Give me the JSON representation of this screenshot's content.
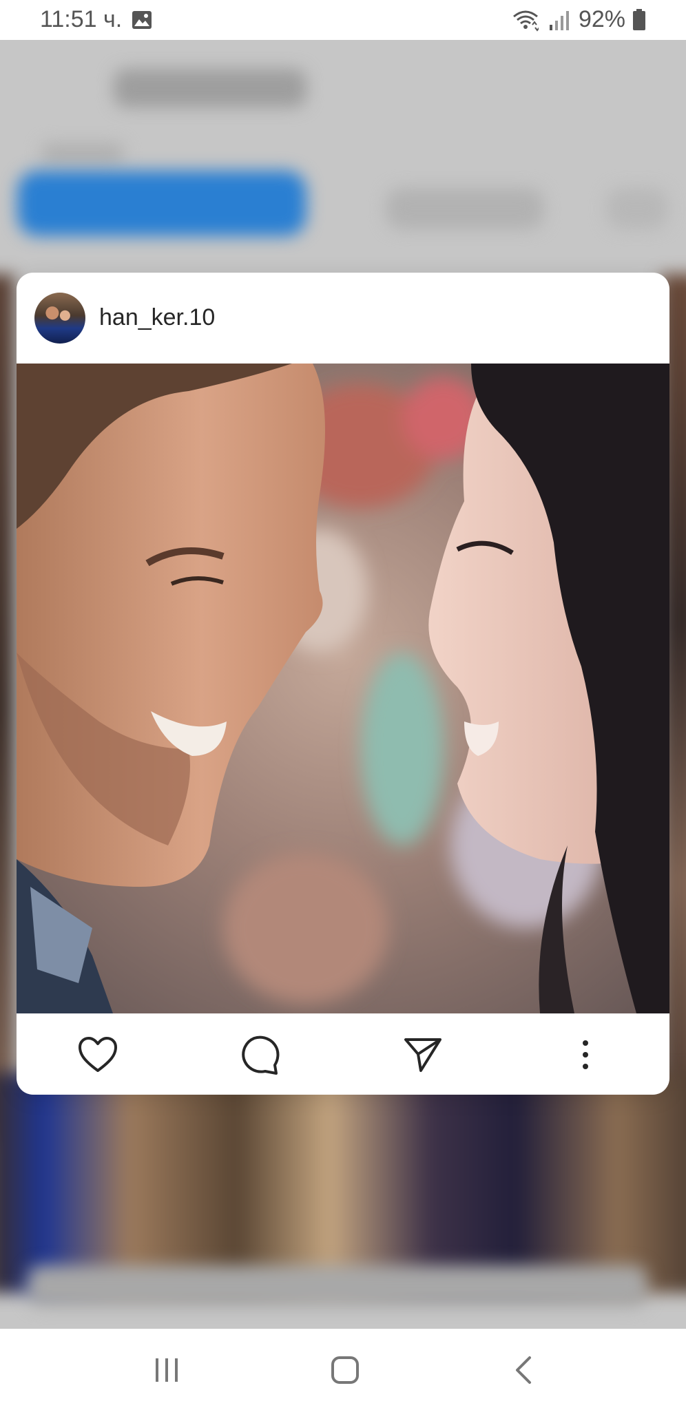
{
  "status_bar": {
    "time": "11:51 ч.",
    "battery": "92%",
    "icons": [
      "gallery-icon",
      "wifi-icon",
      "signal-icon",
      "battery-icon"
    ]
  },
  "post": {
    "username": "han_ker.10",
    "actions": [
      "heart-icon",
      "comment-icon",
      "send-icon",
      "more-icon"
    ]
  },
  "nav_bar": {
    "buttons": [
      "recents-icon",
      "home-icon",
      "back-icon"
    ]
  },
  "colors": {
    "background_blue": "#2a7fd2",
    "text": "#262626",
    "status_text": "#555555"
  }
}
